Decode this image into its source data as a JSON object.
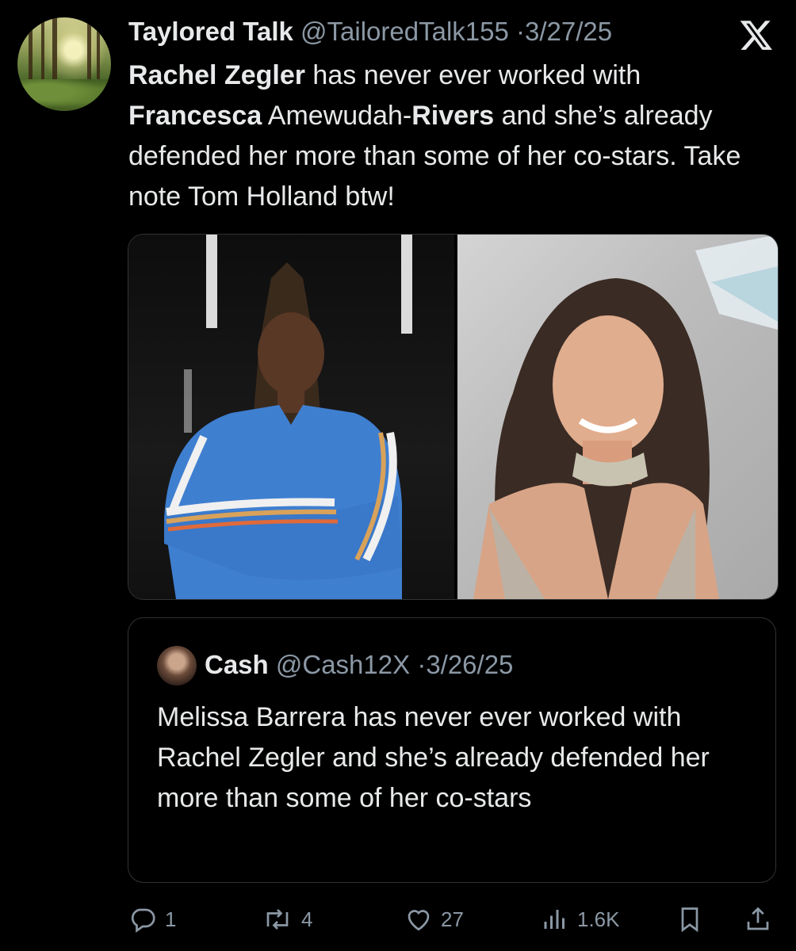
{
  "tweet": {
    "author_name": "Taylored Talk",
    "handle": "@TailoredTalk155",
    "separator": "·",
    "date": "3/27/25",
    "text_segments": [
      {
        "text": "Rachel Zegler",
        "bold": true
      },
      {
        "text": " has never ever worked with ",
        "bold": false
      },
      {
        "text": "Francesca",
        "bold": true
      },
      {
        "text": " Amewudah-",
        "bold": false
      },
      {
        "text": "Rivers",
        "bold": true
      },
      {
        "text": " and she’s already defended her more than some of her co-stars. Take note Tom Holland btw!",
        "bold": false
      }
    ]
  },
  "quoted_tweet": {
    "author_name": "Cash",
    "handle": "@Cash12X",
    "separator": "·",
    "date": "3/26/25",
    "text": "Melissa Barrera has never ever worked with Rachel Zegler and she’s already defended her more than some of her co-stars"
  },
  "actions": {
    "reply_count": "1",
    "repost_count": "4",
    "like_count": "27",
    "views_count": "1.6K"
  },
  "icons": {
    "platform": "x-logo-icon",
    "reply": "reply-icon",
    "repost": "repost-icon",
    "like": "heart-icon",
    "views": "views-icon",
    "bookmark": "bookmark-icon",
    "share": "share-icon"
  },
  "colors": {
    "background": "#000000",
    "text_primary": "#e7e9ea",
    "text_secondary": "#8b98a5",
    "border": "#2f3336"
  }
}
